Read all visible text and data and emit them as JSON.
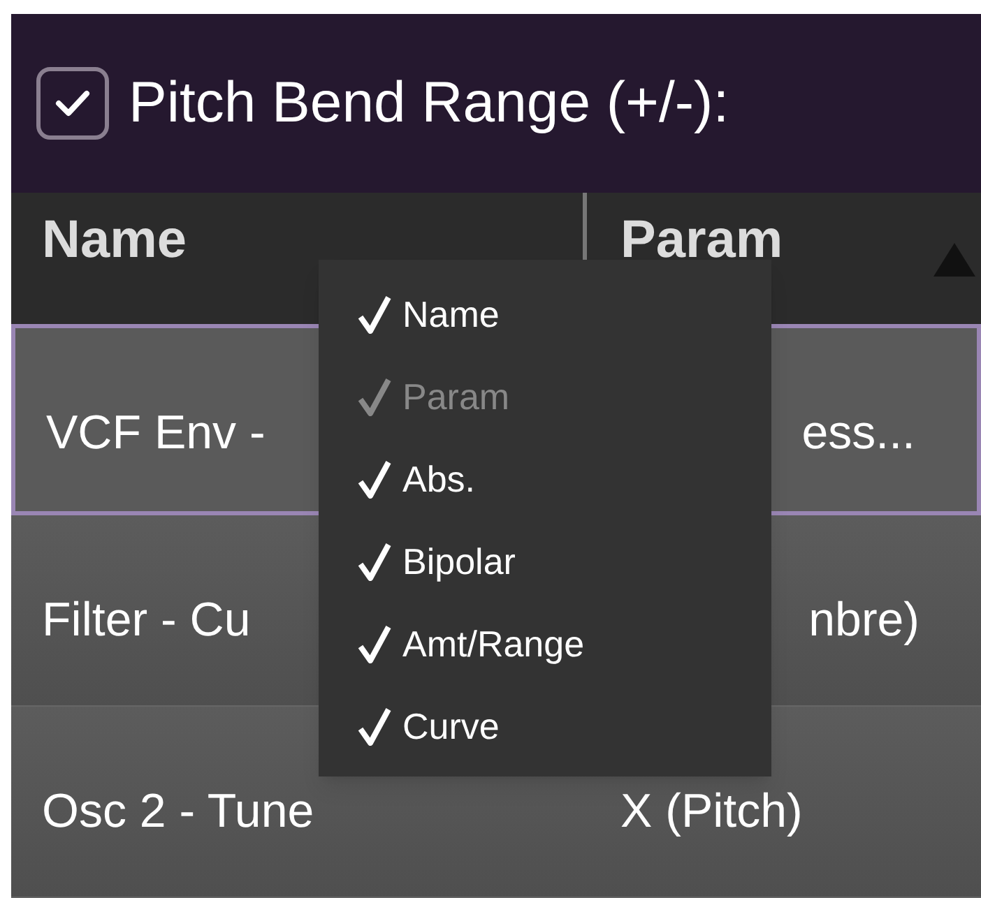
{
  "header": {
    "checkbox": {
      "checked": true
    },
    "label": "Pitch Bend Range (+/-):"
  },
  "table": {
    "columns": [
      {
        "label": "Name",
        "sorted": false
      },
      {
        "label": "Param",
        "sorted": true
      }
    ],
    "rows": [
      {
        "cells": [
          "VCF Env -",
          "ess..."
        ],
        "selected": true
      },
      {
        "cells": [
          "Filter - Cu",
          "nbre)"
        ],
        "selected": false
      },
      {
        "cells": [
          "Osc 2 - Tune",
          "X (Pitch)"
        ],
        "selected": false
      }
    ]
  },
  "column_menu": {
    "items": [
      {
        "label": "Name",
        "checked": true,
        "disabled": false
      },
      {
        "label": "Param",
        "checked": true,
        "disabled": true
      },
      {
        "label": "Abs.",
        "checked": true,
        "disabled": false
      },
      {
        "label": "Bipolar",
        "checked": true,
        "disabled": false
      },
      {
        "label": "Amt/Range",
        "checked": true,
        "disabled": false
      },
      {
        "label": "Curve",
        "checked": true,
        "disabled": false
      }
    ]
  }
}
